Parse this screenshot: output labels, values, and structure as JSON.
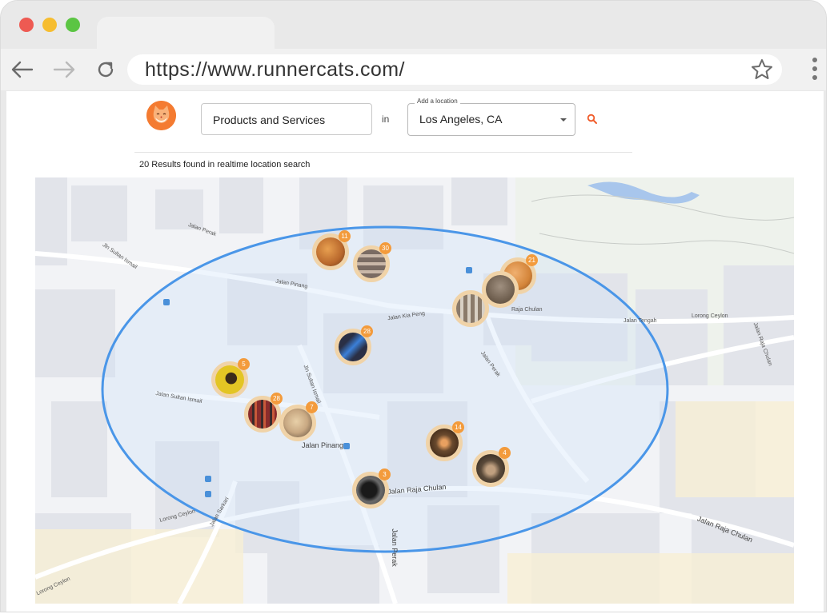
{
  "browser": {
    "url": "https://www.runnercats.com/",
    "traffic_lights": [
      "#ee5a52",
      "#f6bd30",
      "#5bc543"
    ]
  },
  "search": {
    "query": "Products and Services",
    "in_label": "in",
    "location_legend": "Add a location",
    "location_value": "Los Angeles, CA",
    "accent": "#f05a28"
  },
  "results_text": "20 Results found in realtime location search",
  "map": {
    "radius_color": "#4a96e8",
    "streets": [
      "Jalan Perak",
      "Jln Sultan Ismail",
      "Jalan Pinang",
      "Jalan Kia Peng",
      "Raja Chulan",
      "Jalan Tengah",
      "Lorong Ceylon",
      "Jalan Raja Chulan",
      "Jln Sultan Ismail",
      "Jalan Perak",
      "Jalan Sultan Ismail",
      "Jalan Pinang",
      "Jalan Raja Chulan",
      "Jalan Perak",
      "Jalan Sarkari",
      "Lorong Ceylon"
    ],
    "markers": [
      {
        "count": "11",
        "icon": "food-photo",
        "color": "#b9682c"
      },
      {
        "count": "30",
        "icon": "market-photo",
        "color": "#7a6b63"
      },
      {
        "count": "21",
        "icon": "food-photo",
        "color": "#d4853a"
      },
      {
        "count": "28",
        "icon": "sneaker-photo",
        "color": "#2a2f45"
      },
      {
        "count": "5",
        "icon": "mannequin-photo",
        "color": "#e3c524"
      },
      {
        "count": "28",
        "icon": "clothing-photo",
        "color": "#8a2c2c"
      },
      {
        "count": "7",
        "icon": "fashion-photo",
        "color": "#c8a882"
      },
      {
        "count": "14",
        "icon": "dish-photo",
        "color": "#6a4a2e"
      },
      {
        "count": "4",
        "icon": "cafe-photo",
        "color": "#5a4a3a"
      },
      {
        "count": "3",
        "icon": "shoe-photo",
        "color": "#3a3a3a"
      }
    ]
  }
}
